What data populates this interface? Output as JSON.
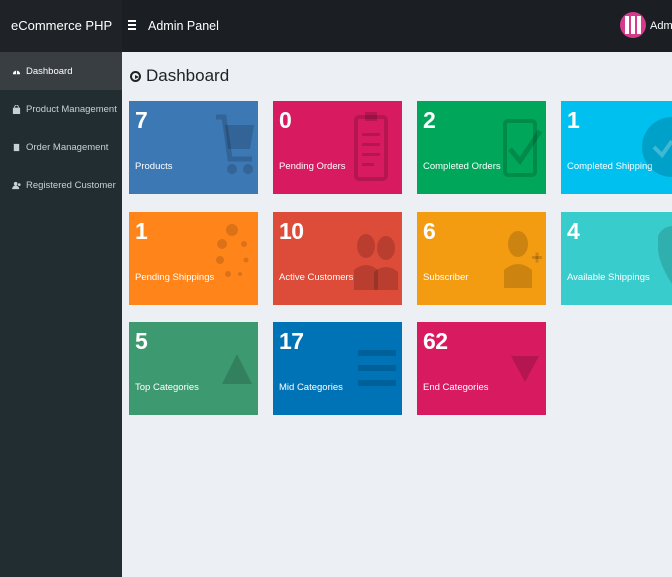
{
  "brand": "eCommerce PHP",
  "header": {
    "title": "Admin Panel",
    "user": "Administrator"
  },
  "sidebar": {
    "items": [
      {
        "label": "Dashboard",
        "icon": "dashboard-icon"
      },
      {
        "label": "Product Management",
        "icon": "shopping-bag-icon"
      },
      {
        "label": "Order Management",
        "icon": "book-icon"
      },
      {
        "label": "Registered Customer",
        "icon": "users-icon"
      }
    ]
  },
  "page": {
    "title": "Dashboard"
  },
  "cards": [
    {
      "value": "7",
      "label": "Products",
      "color": "#3c78b4",
      "icon": "cart-icon"
    },
    {
      "value": "0",
      "label": "Pending Orders",
      "color": "#d81b60",
      "icon": "clipboard-icon"
    },
    {
      "value": "2",
      "label": "Completed Orders",
      "color": "#00a65a",
      "icon": "check-square-icon"
    },
    {
      "value": "1",
      "label": "Completed Shipping",
      "color": "#00c0ef",
      "icon": "check-circle-icon"
    },
    {
      "value": "1",
      "label": "Pending Shippings",
      "color": "#ff851b",
      "icon": "spinner-icon"
    },
    {
      "value": "10",
      "label": "Active Customers",
      "color": "#dd4b39",
      "icon": "users-icon"
    },
    {
      "value": "6",
      "label": "Subscriber",
      "color": "#f39c12",
      "icon": "user-plus-icon"
    },
    {
      "value": "4",
      "label": "Available Shippings",
      "color": "#39cccc",
      "icon": "map-marker-icon"
    },
    {
      "value": "5",
      "label": "Top Categories",
      "color": "#3d9970",
      "icon": "triangle-up-icon"
    },
    {
      "value": "17",
      "label": "Mid Categories",
      "color": "#0073b7",
      "icon": "bars-icon"
    },
    {
      "value": "62",
      "label": "End Categories",
      "color": "#d81b60",
      "icon": "triangle-down-icon"
    }
  ]
}
